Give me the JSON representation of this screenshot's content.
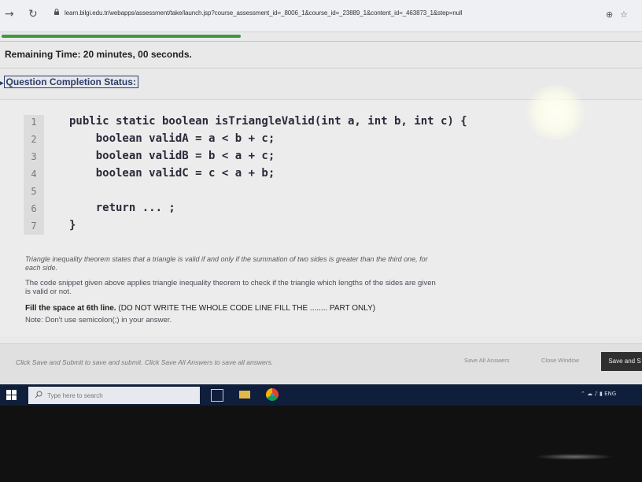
{
  "browser": {
    "url": "learn.bilgi.edu.tr/webapps/assessment/take/launch.jsp?course_assessment_id=_8006_1&course_id=_23889_1&content_id=_463873_1&step=null"
  },
  "quiz": {
    "remaining_time": "Remaining Time: 20 minutes, 00 seconds.",
    "completion_status": "Question Completion Status:",
    "code_lines": [
      {
        "num": "1",
        "text": "public static boolean isTriangleValid(int a, int b, int c) {"
      },
      {
        "num": "2",
        "text": "    boolean validA = a < b + c;"
      },
      {
        "num": "3",
        "text": "    boolean validB = b < a + c;"
      },
      {
        "num": "4",
        "text": "    boolean validC = c < a + b;"
      },
      {
        "num": "5",
        "text": ""
      },
      {
        "num": "6",
        "text": "    return ... ;"
      },
      {
        "num": "7",
        "text": "}"
      }
    ],
    "theorem_text_1": "Triangle inequality theorem states that a triangle is valid if and only if the summation of two sides is greater than the third one, for",
    "theorem_text_2": "each side.",
    "description_1": "The code snippet given above applies triangle inequality theorem to check if the triangle which lengths of the sides are given",
    "description_2": "is valid or not.",
    "instruction_bold": "Fill the space at 6th line.",
    "instruction_rest": " (DO NOT WRITE THE WHOLE CODE LINE FILL THE ........ PART ONLY)",
    "note": "Note: Don't use semicolon(;) in your answer."
  },
  "footer": {
    "hint": "Click Save and Submit to save and submit. Click Save All Answers to save all answers.",
    "save_all_label": "Save All Answers",
    "close_window_label": "Close Window",
    "save_submit_label": "Save and S"
  },
  "taskbar": {
    "search_placeholder": "Type here to search",
    "tray_text": "ENG"
  }
}
